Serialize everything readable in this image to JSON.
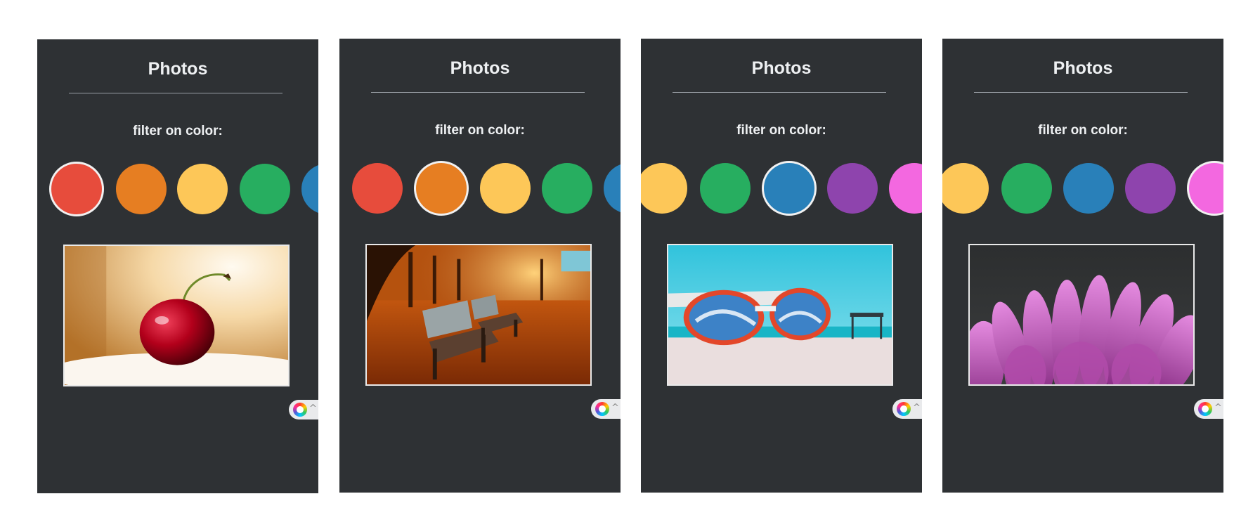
{
  "title": "Photos",
  "filter_label": "filter on color:",
  "colors": {
    "red": "#e74c3c",
    "orange": "#e67e22",
    "yellow": "#fdc758",
    "green": "#27ae60",
    "blue": "#2980b9",
    "purple": "#8e44ad",
    "pink": "#f368e0"
  },
  "panels": [
    {
      "selected_color": "red",
      "photo": "cherry"
    },
    {
      "selected_color": "orange",
      "photo": "autumn-park-benches"
    },
    {
      "selected_color": "blue",
      "photo": "sunglasses-on-beach"
    },
    {
      "selected_color": "pink",
      "photo": "purple-flower"
    }
  ],
  "widget_icon": "color-wheel-icon",
  "widget_chevron": "chevron-up-icon"
}
